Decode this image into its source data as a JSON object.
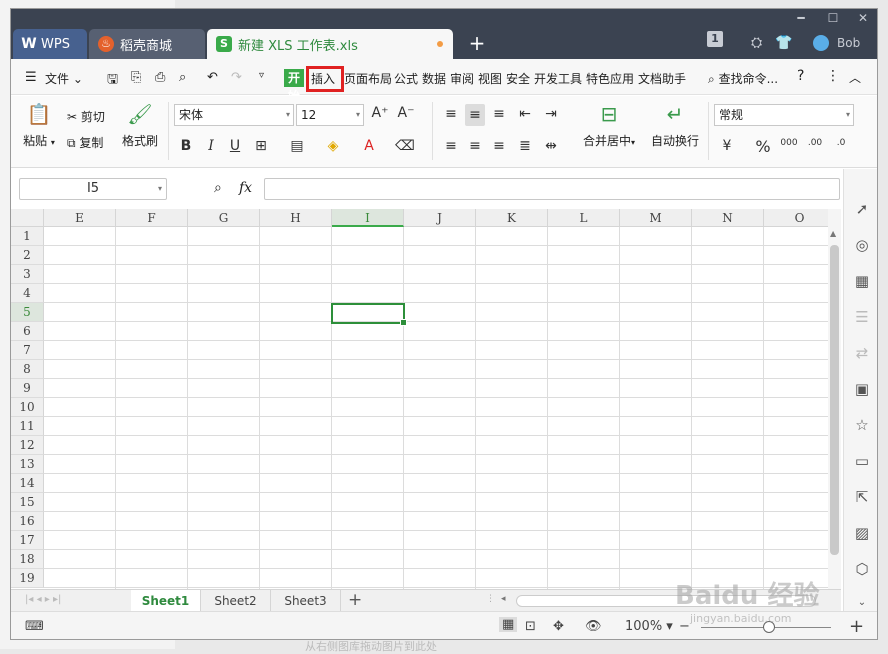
{
  "tabs": {
    "wps": "WPS",
    "docer": "稻壳商城",
    "file": "新建 XLS 工作表.xls"
  },
  "titlebar": {
    "badge": "1",
    "user": "Bob"
  },
  "menu": {
    "file": "文件",
    "start": "开始",
    "insert": "插入",
    "page_layout": "页面布局",
    "formula": "公式",
    "data": "数据",
    "review": "审阅",
    "view": "视图",
    "security": "安全",
    "developer": "开发工具",
    "special": "特色应用",
    "doc_helper": "文档助手",
    "search": "查找命令...",
    "help": "?"
  },
  "ribbon": {
    "paste": "粘贴",
    "cut": "剪切",
    "copy": "复制",
    "format_painter": "格式刷",
    "font_name": "宋体",
    "font_size": "12",
    "merge_center": "合并居中",
    "wrap_text": "自动换行",
    "number_format": "常规",
    "bold": "B",
    "italic": "I",
    "underline": "U",
    "percent": "%"
  },
  "formula_bar": {
    "cell_ref": "I5",
    "fx": "fx",
    "value": ""
  },
  "grid": {
    "columns": [
      "E",
      "F",
      "G",
      "H",
      "I",
      "J",
      "K",
      "L",
      "M",
      "N",
      "O"
    ],
    "active_column": "I",
    "rows": [
      "1",
      "2",
      "3",
      "4",
      "5",
      "6",
      "7",
      "8",
      "9",
      "10",
      "11",
      "12",
      "13",
      "14",
      "15",
      "16",
      "17",
      "18",
      "19"
    ],
    "active_row": "5"
  },
  "sheets": [
    "Sheet1",
    "Sheet2",
    "Sheet3"
  ],
  "active_sheet": "Sheet1",
  "status": {
    "zoom": "100%"
  },
  "caption": "从右侧图库拖动图片到此处",
  "watermark": {
    "brand": "Baidu 经验",
    "url": "jingyan.baidu.com"
  }
}
